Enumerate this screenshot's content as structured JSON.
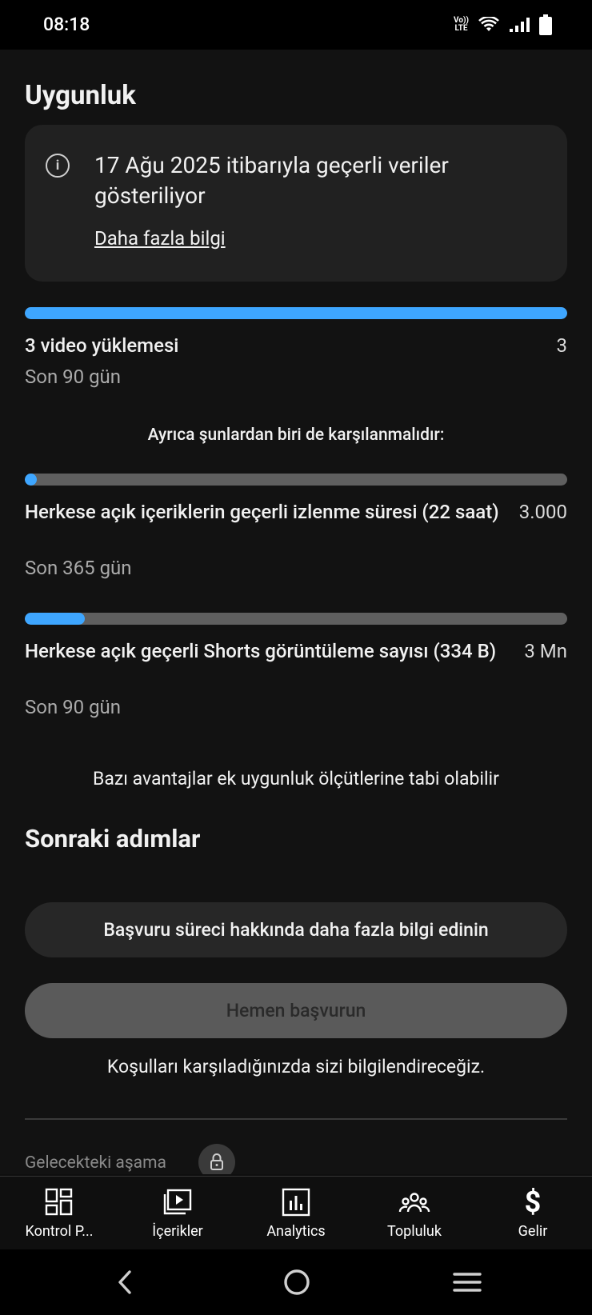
{
  "status_bar": {
    "time": "08:18",
    "volte_top": "Vo))",
    "volte_bottom": "LTE"
  },
  "page": {
    "section_title": "Uygunluk",
    "info_card": {
      "text": "17 Ağu 2025 itibarıyla geçerli veriler gösteriliyor",
      "link": "Daha fazla bilgi"
    },
    "requirements": [
      {
        "label": "3 video yüklemesi",
        "value": "3",
        "period": "Son 90 gün",
        "progress_percent": 100
      },
      {
        "label": "Herkese açık içeriklerin geçerli izlenme süresi (22 saat)",
        "value": "3.000",
        "period": "Son 365 gün",
        "progress_percent": 1
      },
      {
        "label": "Herkese açık geçerli Shorts görüntüleme sayısı (334 B)",
        "value": "3 Mn",
        "period": "Son 90 gün",
        "progress_percent": 11
      }
    ],
    "also_required": "Ayrıca şunlardan biri de karşılanmalıdır:",
    "eligibility_note": "Bazı avantajlar ek uygunluk ölçütlerine tabi olabilir",
    "next_steps_title": "Sonraki adımlar",
    "learn_button": "Başvuru süreci hakkında daha fazla bilgi edinin",
    "apply_button": "Hemen başvurun",
    "notify_text": "Koşulları karşıladığınızda sizi bilgilendireceğiz.",
    "future_stage": "Gelecekteki aşama"
  },
  "bottom_nav": {
    "items": [
      {
        "label": "Kontrol P...",
        "icon": "dashboard-icon"
      },
      {
        "label": "İçerikler",
        "icon": "content-icon"
      },
      {
        "label": "Analytics",
        "icon": "analytics-icon"
      },
      {
        "label": "Topluluk",
        "icon": "community-icon"
      },
      {
        "label": "Gelir",
        "icon": "dollar-icon"
      }
    ]
  },
  "colors": {
    "accent": "#3ea6ff",
    "background": "#121212",
    "card": "#212121"
  }
}
